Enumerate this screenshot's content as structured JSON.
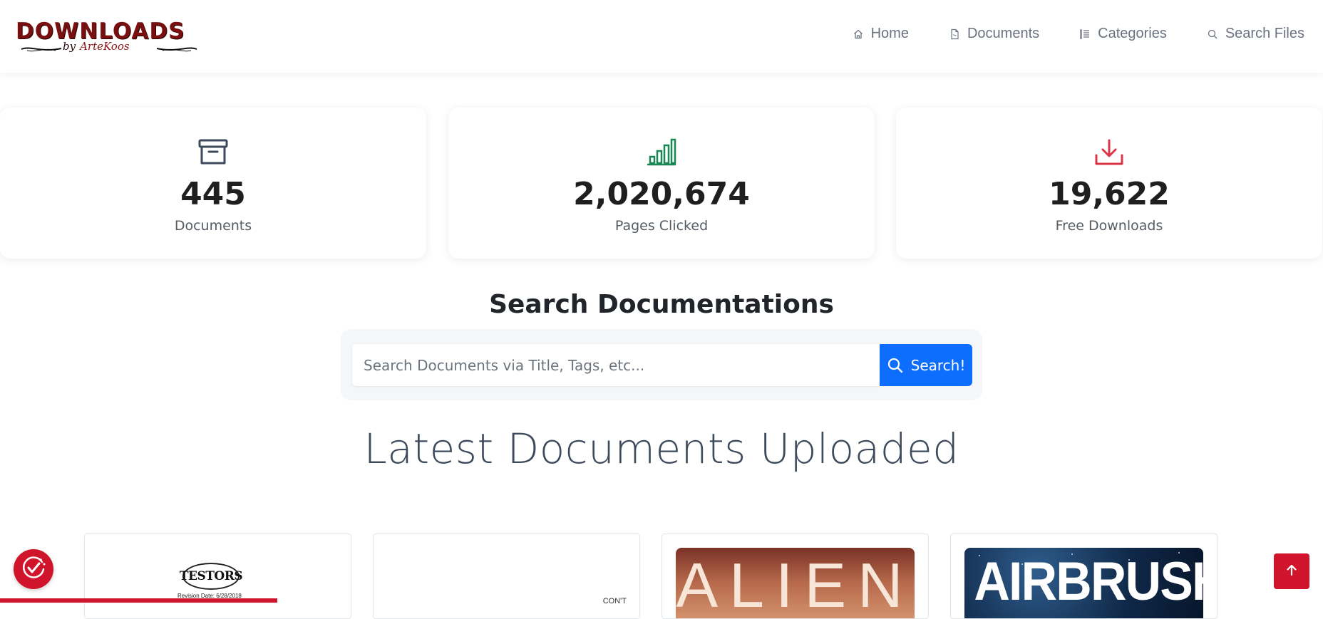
{
  "brand": {
    "title": "DOWNLOADS",
    "by": "by",
    "name": "ArteKoos",
    "color": "#7a0f0f"
  },
  "nav": {
    "items": [
      {
        "label": "Home",
        "icon": "home-icon"
      },
      {
        "label": "Documents",
        "icon": "document-icon"
      },
      {
        "label": "Categories",
        "icon": "list-icon"
      },
      {
        "label": "Search Files",
        "icon": "search-icon"
      }
    ]
  },
  "stats": [
    {
      "value": "445",
      "label": "Documents",
      "icon": "archive-box-icon",
      "color": "#3d4a5c"
    },
    {
      "value": "2,020,674",
      "label": "Pages Clicked",
      "icon": "bar-chart-icon",
      "color": "#198754"
    },
    {
      "value": "19,622",
      "label": "Free Downloads",
      "icon": "download-icon",
      "color": "#dc3545"
    }
  ],
  "search": {
    "title": "Search Documentations",
    "placeholder": "Search Documents via Title, Tags, etc...",
    "value": "",
    "button_label": "Search!",
    "button_color": "#0d6efd"
  },
  "latest": {
    "title": "Latest Documents Uploaded",
    "cards": [
      {
        "thumb_text": "TESTORS",
        "thumb_subtext": "Revision Date: 6/28/2018"
      },
      {
        "thumb_text": "CON'T"
      },
      {
        "thumb_text": "ALIEN"
      },
      {
        "thumb_text": "AIRBRUSH"
      }
    ]
  },
  "accent_color": "#d0142c"
}
